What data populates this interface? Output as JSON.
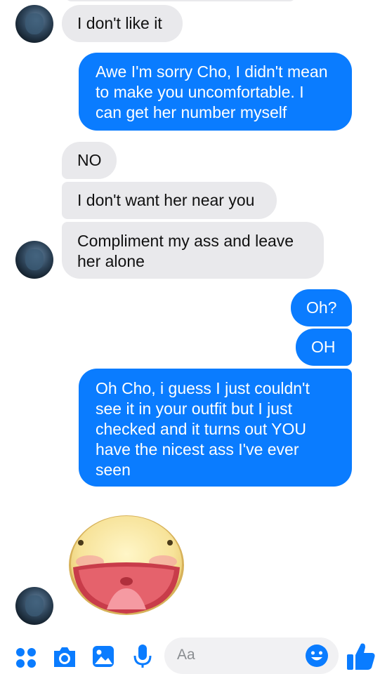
{
  "messages": [
    {
      "dir": "in",
      "text": "I don't like it"
    },
    {
      "dir": "out",
      "lines": [
        "Awe I'm sorry Cho, I didn't mean",
        "to make you uncomfortable.  I",
        "can get her number myself"
      ]
    },
    {
      "dir": "in",
      "text": "NO"
    },
    {
      "dir": "in",
      "text": "I don't want her near you"
    },
    {
      "dir": "in",
      "lines": [
        "Compliment my ass and leave",
        "her alone"
      ]
    },
    {
      "dir": "out",
      "text": "Oh?"
    },
    {
      "dir": "out",
      "text": "OH"
    },
    {
      "dir": "out",
      "lines": [
        "Oh Cho, i guess I just couldn't",
        "see it in your outfit but I just",
        "checked and it turns out YOU",
        "have the nicest ass I've ever",
        "seen"
      ]
    }
  ],
  "sticker": "laughing-face-sticker",
  "composer": {
    "placeholder": "Aa",
    "icons": [
      "apps-icon",
      "camera-icon",
      "gallery-icon",
      "microphone-icon",
      "emoji-icon",
      "thumbs-up-icon"
    ],
    "accent": "#0a7cff"
  },
  "colors": {
    "incoming": "#e9e9ec",
    "outgoing": "#0a7cff"
  }
}
